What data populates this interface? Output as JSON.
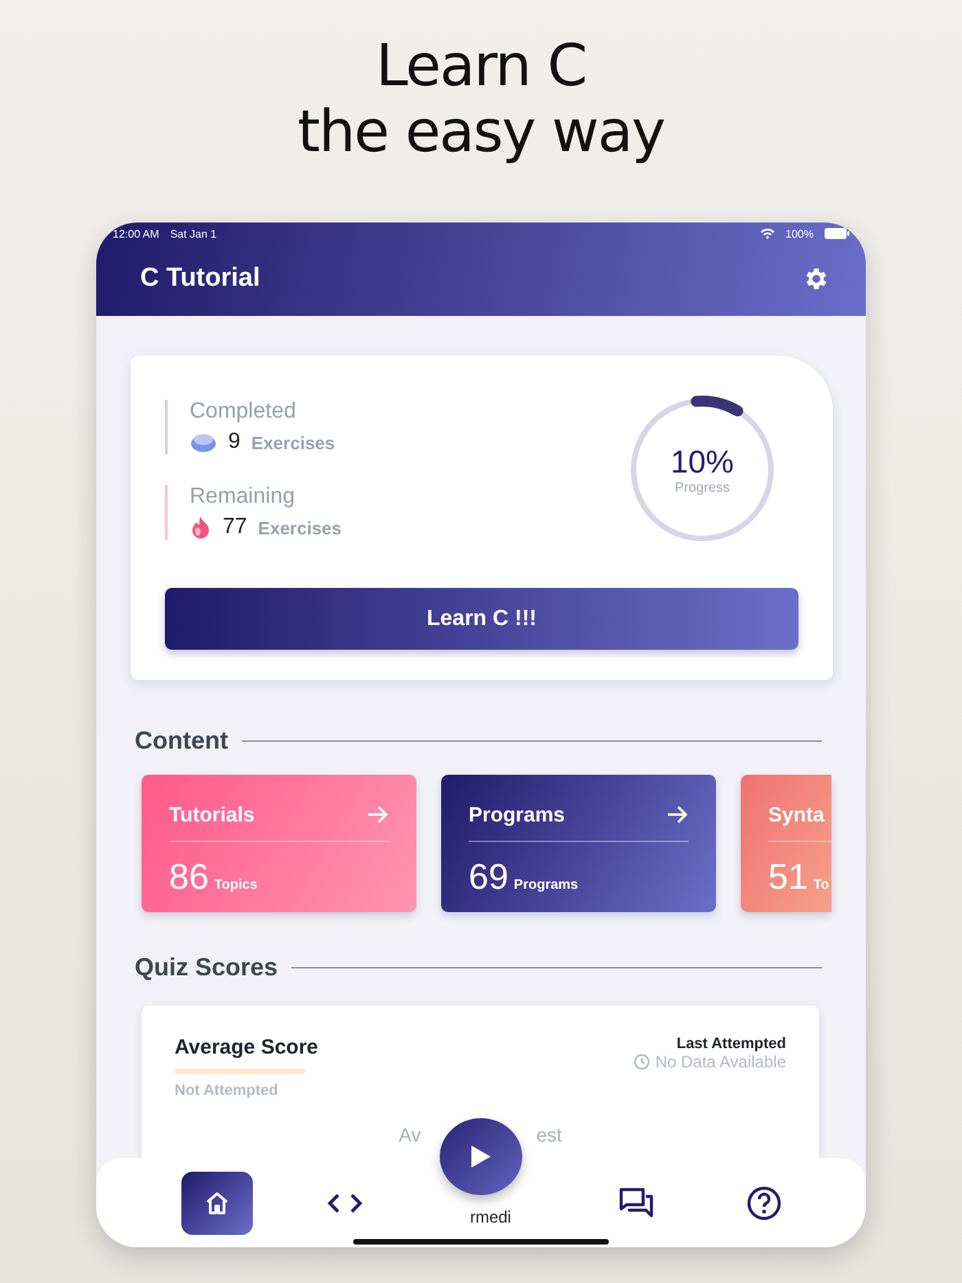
{
  "headline": [
    "Learn C",
    "the easy way"
  ],
  "status_bar": {
    "time": "12:00 AM",
    "date": "Sat Jan 1",
    "battery": "100%"
  },
  "header": {
    "title": "C Tutorial"
  },
  "summary": {
    "stats": [
      {
        "label": "Completed",
        "count": "9",
        "unit": "Exercises",
        "color": "#c9d3f0",
        "kind": "drop"
      },
      {
        "label": "Remaining",
        "count": "77",
        "unit": "Exercises",
        "color": "#f7c3d2",
        "kind": "flame"
      }
    ],
    "progress": {
      "value": "10%",
      "caption": "Progress",
      "level": 0.1
    },
    "button": "Learn C !!!"
  },
  "content": {
    "title": "Content",
    "cards": [
      {
        "title": "Tutorials",
        "count": "86",
        "unit": "Topics",
        "color": "#ff5a88",
        "arrow": true
      },
      {
        "title": "Programs",
        "count": "69",
        "unit": "Programs",
        "color": "#231a6b",
        "arrow": true
      },
      {
        "title": "Synta",
        "count": "51",
        "unit": "To",
        "color": "#f07272",
        "arrow": false
      }
    ]
  },
  "quiz": {
    "title": "Quiz Scores",
    "card": {
      "title": "Average Score",
      "status": "Not Attempted",
      "last_label": "Last Attempted",
      "last_value": "No Data Available",
      "peek_left": "Av",
      "peek_right": "est",
      "peek_below": "rmedi"
    }
  },
  "nav": [
    {
      "kind": "home",
      "selected": true
    },
    {
      "kind": "code",
      "selected": false
    },
    {
      "kind": "chat",
      "selected": false
    },
    {
      "kind": "help",
      "selected": false
    }
  ]
}
